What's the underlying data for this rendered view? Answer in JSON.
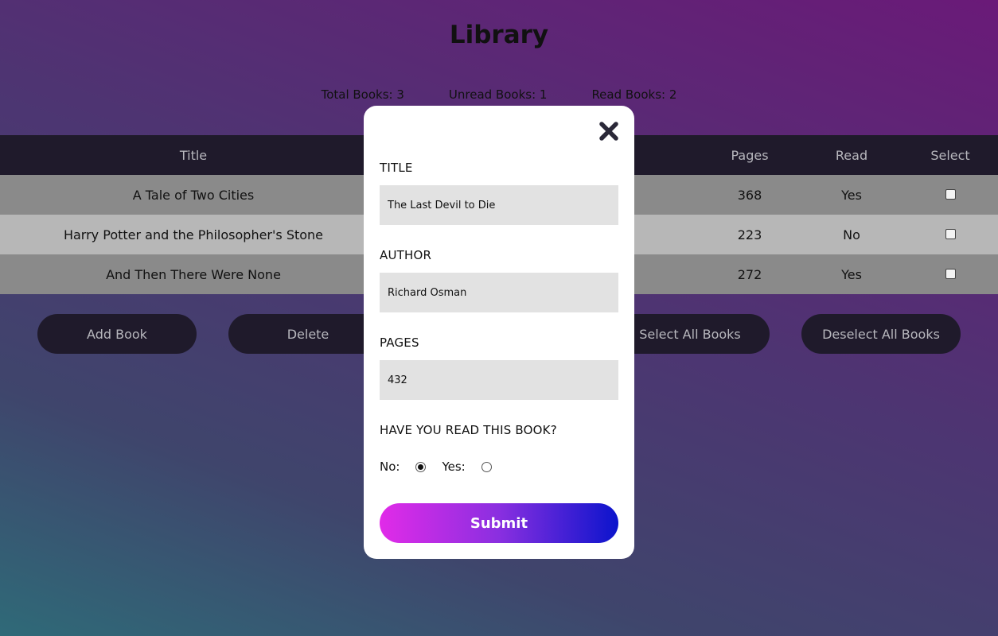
{
  "header": {
    "title": "Library"
  },
  "stats": {
    "total": "Total Books: 3",
    "unread": "Unread Books: 1",
    "read": "Read Books: 2"
  },
  "table": {
    "columns": {
      "title": "Title",
      "pages": "Pages",
      "read": "Read",
      "select": "Select"
    },
    "rows": [
      {
        "title": "A Tale of Two Cities",
        "pages": "368",
        "read": "Yes",
        "selected": false
      },
      {
        "title": "Harry Potter and the Philosopher's Stone",
        "pages": "223",
        "read": "No",
        "selected": false
      },
      {
        "title": "And Then There Were None",
        "pages": "272",
        "read": "Yes",
        "selected": false
      }
    ]
  },
  "buttons": {
    "add": "Add Book",
    "delete": "Delete",
    "select_all": "Select All Books",
    "deselect_all": "Deselect All Books"
  },
  "modal": {
    "close_icon": "close-x-icon",
    "title_label": "TITLE",
    "title_value": "The Last Devil to Die",
    "author_label": "AUTHOR",
    "author_value": "Richard Osman",
    "pages_label": "PAGES",
    "pages_value": "432",
    "read_question": "HAVE YOU READ THIS BOOK?",
    "no_label": "No:",
    "yes_label": "Yes:",
    "read_selected": "No",
    "submit_label": "Submit"
  },
  "colors": {
    "header_bg": "#1f1a2b",
    "row_odd": "#8a8a8a",
    "row_even": "#b7b7b7",
    "submit_gradient_start": "#e12be8",
    "submit_gradient_end": "#0b14cc"
  }
}
